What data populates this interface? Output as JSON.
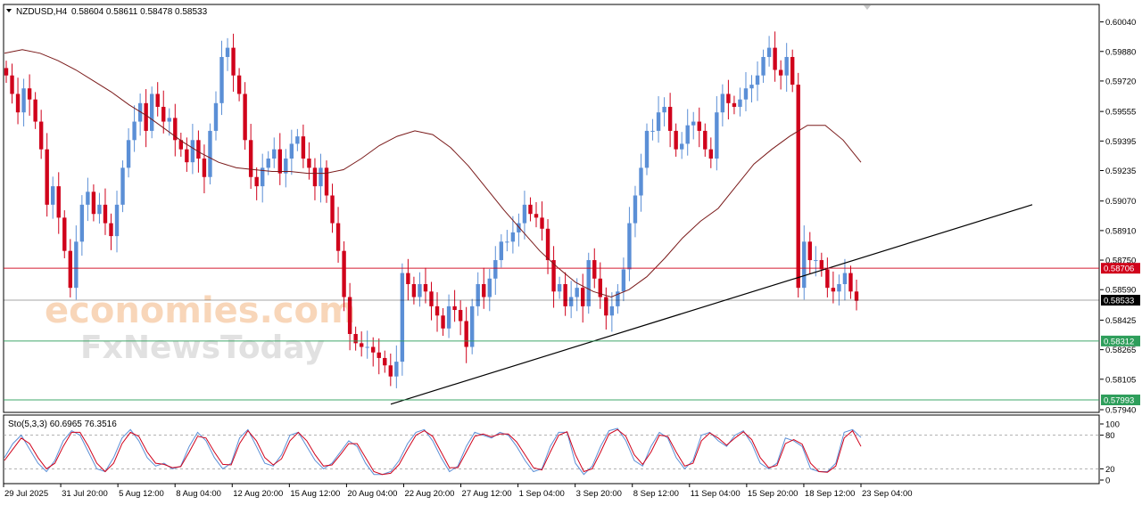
{
  "header": {
    "symbol": "NZDUSD,H4",
    "ohlc": "0.58604 0.58611 0.58478 0.58533"
  },
  "watermark": {
    "line1": "economies.com",
    "line2": "FxNewsToday"
  },
  "chart_data": [
    {
      "type": "candlestick",
      "symbol": "NZDUSD",
      "timeframe": "H4",
      "open": 0.58604,
      "high": 0.58611,
      "low": 0.58478,
      "close": 0.58533,
      "ylim": [
        0.5794,
        0.6012
      ],
      "y_ticks": [
        "0.60040",
        "0.59880",
        "0.59720",
        "0.59555",
        "0.59395",
        "0.59235",
        "0.59070",
        "0.58910",
        "0.58750",
        "0.58590",
        "0.58425",
        "0.58265",
        "0.58105",
        "0.57940"
      ],
      "x_ticks": [
        "29 Jul 2025",
        "31 Jul 20:00",
        "5 Aug 12:00",
        "8 Aug 04:00",
        "12 Aug 20:00",
        "15 Aug 12:00",
        "20 Aug 04:00",
        "22 Aug 20:00",
        "27 Aug 12:00",
        "1 Sep 04:00",
        "3 Sep 20:00",
        "8 Sep 12:00",
        "11 Sep 04:00",
        "15 Sep 20:00",
        "18 Sep 12:00",
        "23 Sep 04:00"
      ],
      "closes": [
        0.5975,
        0.5965,
        0.5955,
        0.5968,
        0.5962,
        0.595,
        0.5935,
        0.5905,
        0.5915,
        0.5898,
        0.588,
        0.586,
        0.5885,
        0.5905,
        0.5912,
        0.59,
        0.5905,
        0.5895,
        0.5888,
        0.5905,
        0.5925,
        0.594,
        0.595,
        0.596,
        0.5945,
        0.5965,
        0.5958,
        0.595,
        0.5952,
        0.594,
        0.5935,
        0.5928,
        0.594,
        0.593,
        0.592,
        0.5945,
        0.596,
        0.5985,
        0.599,
        0.5975,
        0.5965,
        0.594,
        0.592,
        0.5915,
        0.5925,
        0.593,
        0.5935,
        0.5922,
        0.593,
        0.5938,
        0.5942,
        0.593,
        0.5925,
        0.5915,
        0.5925,
        0.591,
        0.5895,
        0.588,
        0.5855,
        0.5835,
        0.583,
        0.5828,
        0.5828,
        0.5825,
        0.5822,
        0.5818,
        0.5812,
        0.582,
        0.5868,
        0.5862,
        0.5855,
        0.5862,
        0.5858,
        0.585,
        0.5845,
        0.5838,
        0.585,
        0.5848,
        0.5842,
        0.5828,
        0.585,
        0.5862,
        0.5855,
        0.5865,
        0.5875,
        0.5885,
        0.5885,
        0.589,
        0.5895,
        0.5905,
        0.59,
        0.5898,
        0.5892,
        0.5875,
        0.5858,
        0.5862,
        0.585,
        0.5855,
        0.586,
        0.585,
        0.5875,
        0.5865,
        0.5855,
        0.5845,
        0.585,
        0.5858,
        0.587,
        0.5895,
        0.591,
        0.5925,
        0.5945,
        0.5945,
        0.5955,
        0.5958,
        0.5945,
        0.5935,
        0.5938,
        0.5948,
        0.595,
        0.5945,
        0.5935,
        0.593,
        0.5955,
        0.5965,
        0.596,
        0.5958,
        0.5962,
        0.5968,
        0.597,
        0.5975,
        0.5985,
        0.599,
        0.5978,
        0.5975,
        0.5985,
        0.597,
        0.586,
        0.5885,
        0.5875,
        0.5875,
        0.587,
        0.586,
        0.5858,
        0.5862,
        0.5868,
        0.5858,
        0.5853
      ],
      "moving_average": [
        0.5987,
        0.5989,
        0.5987,
        0.5983,
        0.5978,
        0.5972,
        0.5966,
        0.5959,
        0.5953,
        0.5946,
        0.5939,
        0.5933,
        0.5928,
        0.5925,
        0.5924,
        0.5923,
        0.5923,
        0.5922,
        0.5922,
        0.5924,
        0.593,
        0.5937,
        0.5942,
        0.5945,
        0.5943,
        0.5936,
        0.5926,
        0.5914,
        0.5902,
        0.5891,
        0.588,
        0.5871,
        0.5863,
        0.5858,
        0.5855,
        0.5859,
        0.5866,
        0.5876,
        0.5887,
        0.5896,
        0.5903,
        0.5915,
        0.5927,
        0.5935,
        0.5942,
        0.5948,
        0.5948,
        0.594,
        0.5928
      ],
      "horizontal_levels": [
        {
          "value": 0.58706,
          "label": "0.58706",
          "color": "#d0021b"
        },
        {
          "value": 0.58533,
          "label": "0.58533",
          "color": "#000000"
        },
        {
          "value": 0.58312,
          "label": "0.58312",
          "color": "#2e9e5b"
        },
        {
          "value": 0.57993,
          "label": "0.57993",
          "color": "#2e9e5b"
        }
      ],
      "trendline": {
        "from": 0.5797,
        "to": 0.5905
      },
      "colors": {
        "bull": "#5b8fd6",
        "bear": "#d0021b",
        "ma": "#7a1a1a"
      }
    },
    {
      "type": "line",
      "indicator_label": "Sto(5,3,3) 60.6965 76.3516",
      "ylim": [
        0,
        100
      ],
      "y_ticks": [
        "100",
        "80",
        "20",
        "0"
      ],
      "levels": [
        80,
        20
      ],
      "series": [
        {
          "name": "60.6965",
          "color": "#5b8fd6",
          "values": [
            40,
            65,
            80,
            55,
            30,
            15,
            35,
            70,
            88,
            80,
            50,
            20,
            15,
            40,
            75,
            90,
            70,
            40,
            25,
            30,
            20,
            25,
            60,
            85,
            70,
            40,
            20,
            30,
            75,
            90,
            60,
            30,
            25,
            45,
            80,
            85,
            60,
            35,
            20,
            30,
            50,
            70,
            60,
            30,
            10,
            10,
            15,
            35,
            65,
            85,
            90,
            70,
            40,
            15,
            25,
            60,
            85,
            80,
            75,
            85,
            80,
            60,
            35,
            15,
            20,
            60,
            85,
            85,
            30,
            10,
            25,
            60,
            88,
            92,
            70,
            35,
            25,
            60,
            85,
            75,
            40,
            20,
            35,
            80,
            85,
            70,
            60,
            80,
            88,
            65,
            30,
            20,
            30,
            75,
            70,
            60,
            20,
            15,
            15,
            30,
            85,
            90,
            76
          ]
        },
        {
          "name": "76.3516",
          "color": "#d0021b",
          "values": [
            35,
            55,
            75,
            65,
            40,
            20,
            30,
            60,
            85,
            85,
            60,
            30,
            15,
            30,
            65,
            85,
            78,
            50,
            30,
            28,
            22,
            24,
            50,
            78,
            75,
            50,
            28,
            27,
            65,
            88,
            70,
            40,
            27,
            38,
            70,
            85,
            70,
            45,
            25,
            27,
            45,
            65,
            65,
            40,
            15,
            10,
            12,
            28,
            55,
            80,
            88,
            78,
            50,
            22,
            22,
            50,
            78,
            82,
            77,
            82,
            82,
            68,
            45,
            22,
            18,
            50,
            80,
            86,
            45,
            15,
            20,
            50,
            82,
            90,
            78,
            45,
            28,
            50,
            80,
            78,
            50,
            25,
            30,
            70,
            84,
            75,
            62,
            75,
            86,
            72,
            40,
            22,
            26,
            65,
            72,
            64,
            30,
            15,
            14,
            25,
            75,
            88,
            60
          ]
        }
      ]
    }
  ]
}
